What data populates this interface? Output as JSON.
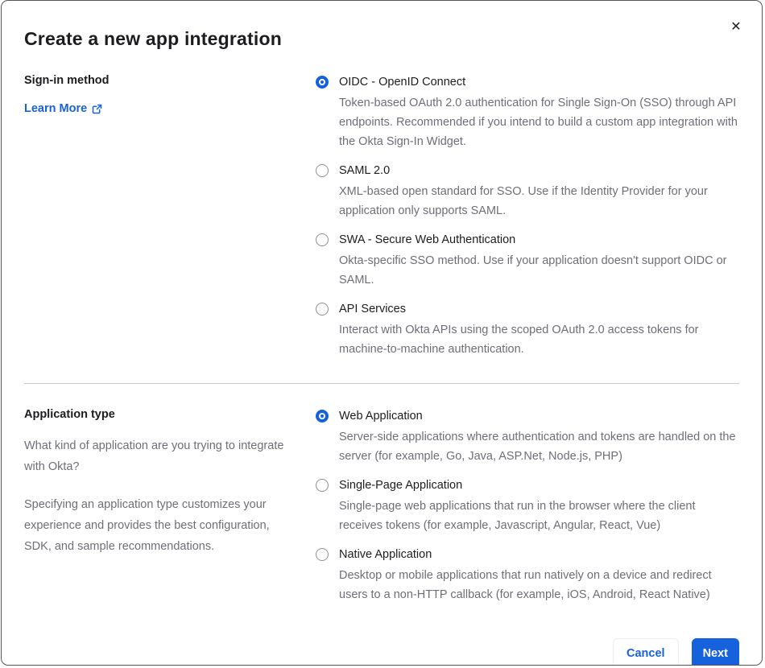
{
  "modal": {
    "title": "Create a new app integration",
    "close_icon": "✕"
  },
  "signin_section": {
    "heading": "Sign-in method",
    "learn_more_label": "Learn More",
    "options": [
      {
        "label": "OIDC - OpenID Connect",
        "description": "Token-based OAuth 2.0 authentication for Single Sign-On (SSO) through API endpoints. Recommended if you intend to build a custom app integration with the Okta Sign-In Widget.",
        "selected": true
      },
      {
        "label": "SAML 2.0",
        "description": "XML-based open standard for SSO. Use if the Identity Provider for your application only supports SAML.",
        "selected": false
      },
      {
        "label": "SWA - Secure Web Authentication",
        "description": "Okta-specific SSO method. Use if your application doesn't support OIDC or SAML.",
        "selected": false
      },
      {
        "label": "API Services",
        "description": "Interact with Okta APIs using the scoped OAuth 2.0 access tokens for machine-to-machine authentication.",
        "selected": false
      }
    ]
  },
  "apptype_section": {
    "heading": "Application type",
    "paragraph1": "What kind of application are you trying to integrate with Okta?",
    "paragraph2": "Specifying an application type customizes your experience and provides the best configuration, SDK, and sample recommendations.",
    "options": [
      {
        "label": "Web Application",
        "description": "Server-side applications where authentication and tokens are handled on the server (for example, Go, Java, ASP.Net, Node.js, PHP)",
        "selected": true
      },
      {
        "label": "Single-Page Application",
        "description": "Single-page web applications that run in the browser where the client receives tokens (for example, Javascript, Angular, React, Vue)",
        "selected": false
      },
      {
        "label": "Native Application",
        "description": "Desktop or mobile applications that run natively on a device and redirect users to a non-HTTP callback (for example, iOS, Android, React Native)",
        "selected": false
      }
    ]
  },
  "footer": {
    "cancel_label": "Cancel",
    "next_label": "Next"
  },
  "colors": {
    "primary_blue": "#1662dd",
    "text_dark": "#1d1d21",
    "text_gray": "#6e6e78",
    "border_gray": "#c9c9cf"
  }
}
